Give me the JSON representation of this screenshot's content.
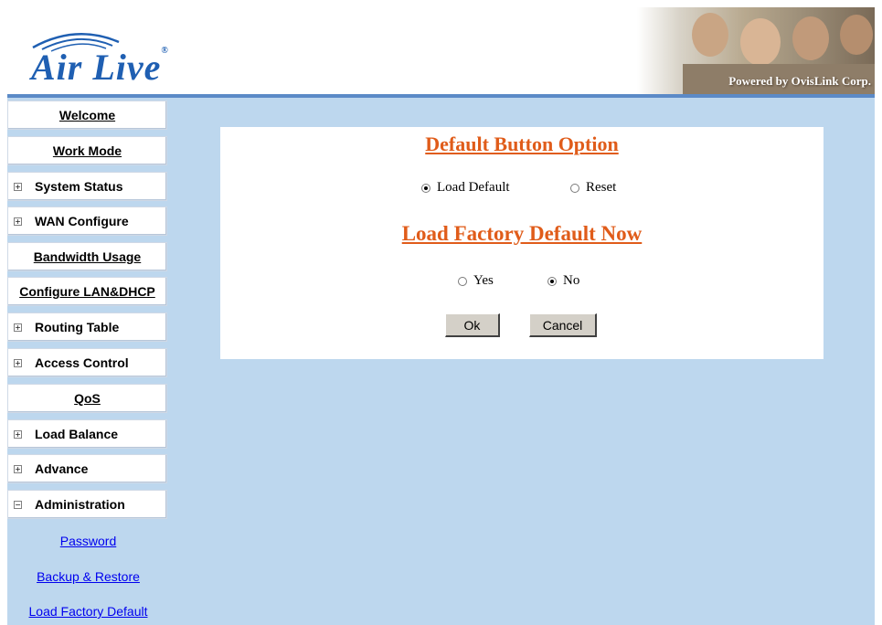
{
  "header": {
    "logo_text": "Air Live",
    "logo_reg": "®",
    "powered_by": "Powered by OvisLink Corp."
  },
  "sidebar": {
    "items": [
      {
        "label": "Welcome",
        "expand": false
      },
      {
        "label": "Work Mode",
        "expand": false
      },
      {
        "label": "System Status",
        "expand": true,
        "icon": "⊞"
      },
      {
        "label": "WAN Configure",
        "expand": true,
        "icon": "⊞"
      },
      {
        "label": "Bandwidth Usage",
        "expand": false
      },
      {
        "label": "Configure LAN&DHCP",
        "expand": false
      },
      {
        "label": "Routing Table",
        "expand": true,
        "icon": "⊞"
      },
      {
        "label": "Access Control",
        "expand": true,
        "icon": "⊞"
      },
      {
        "label": "QoS",
        "expand": false
      },
      {
        "label": "Load Balance",
        "expand": true,
        "icon": "⊞"
      },
      {
        "label": "Advance",
        "expand": true,
        "icon": "⊞"
      },
      {
        "label": "Administration",
        "expand": true,
        "icon": "⊟"
      }
    ],
    "sub_links": [
      "Password",
      "Backup & Restore",
      "Load Factory Default"
    ]
  },
  "main": {
    "section1_title": "Default Button Option",
    "option_load_default": "Load Default",
    "option_reset": "Reset",
    "section2_title": "Load Factory Default Now",
    "option_yes": "Yes",
    "option_no": "No",
    "ok_label": "Ok",
    "cancel_label": "Cancel"
  },
  "colors": {
    "title_orange": "#e05c1a",
    "content_bg": "#bdd7ee",
    "link_blue": "#0000ee"
  }
}
